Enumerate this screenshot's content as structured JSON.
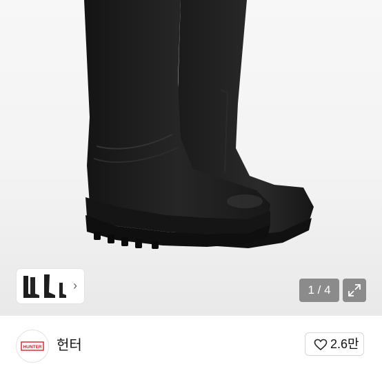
{
  "gallery": {
    "counter_text": "1 / 4",
    "next_glyph": "›",
    "expand_icon": "expand-icon"
  },
  "shop": {
    "logo_text": "HUNTER",
    "name": "헌터",
    "like_icon": "heart-outline-icon",
    "like_count": "2.6만"
  },
  "colors": {
    "boot": "#1f1f1f",
    "overlay": "#707070",
    "logo_red": "#d3222a"
  }
}
